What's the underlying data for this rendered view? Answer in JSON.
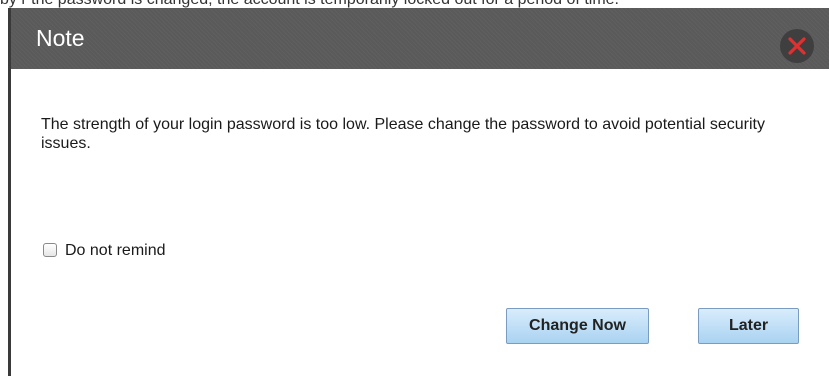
{
  "background_fragment": "by                       r the password is changed, the account is temporarily locked out for a period of time.",
  "dialog": {
    "title": "Note",
    "close_icon": "close-icon",
    "message": "The strength of your login password is too low. Please change the password to avoid potential security issues.",
    "remind_checkbox": {
      "label": "Do not remind",
      "checked": false
    },
    "buttons": {
      "change_now": "Change Now",
      "later": "Later"
    }
  },
  "colors": {
    "titlebar": "#5a5a5a",
    "close_x": "#e03030",
    "button_gradient_top": "#d9ecfb",
    "button_gradient_bottom": "#a9d3f2"
  }
}
